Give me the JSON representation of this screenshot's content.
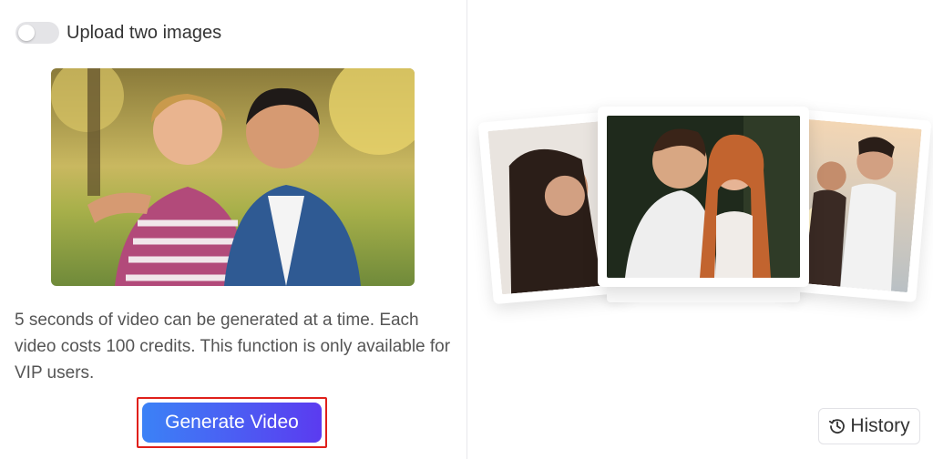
{
  "toggle": {
    "label": "Upload two images",
    "on": false
  },
  "upload_image": {
    "alt": "Couple photo"
  },
  "description": "5 seconds of video can be generated at a time. Each video costs 100 credits. This function is only available for VIP users.",
  "generate_button": {
    "label": "Generate Video"
  },
  "history_button": {
    "label": "History",
    "icon": "history-icon"
  },
  "colors": {
    "button_gradient_start": "#3b82f6",
    "button_gradient_end": "#5b3bf0",
    "highlight_border": "#e0201b",
    "toggle_off": "#e4e4e7"
  }
}
